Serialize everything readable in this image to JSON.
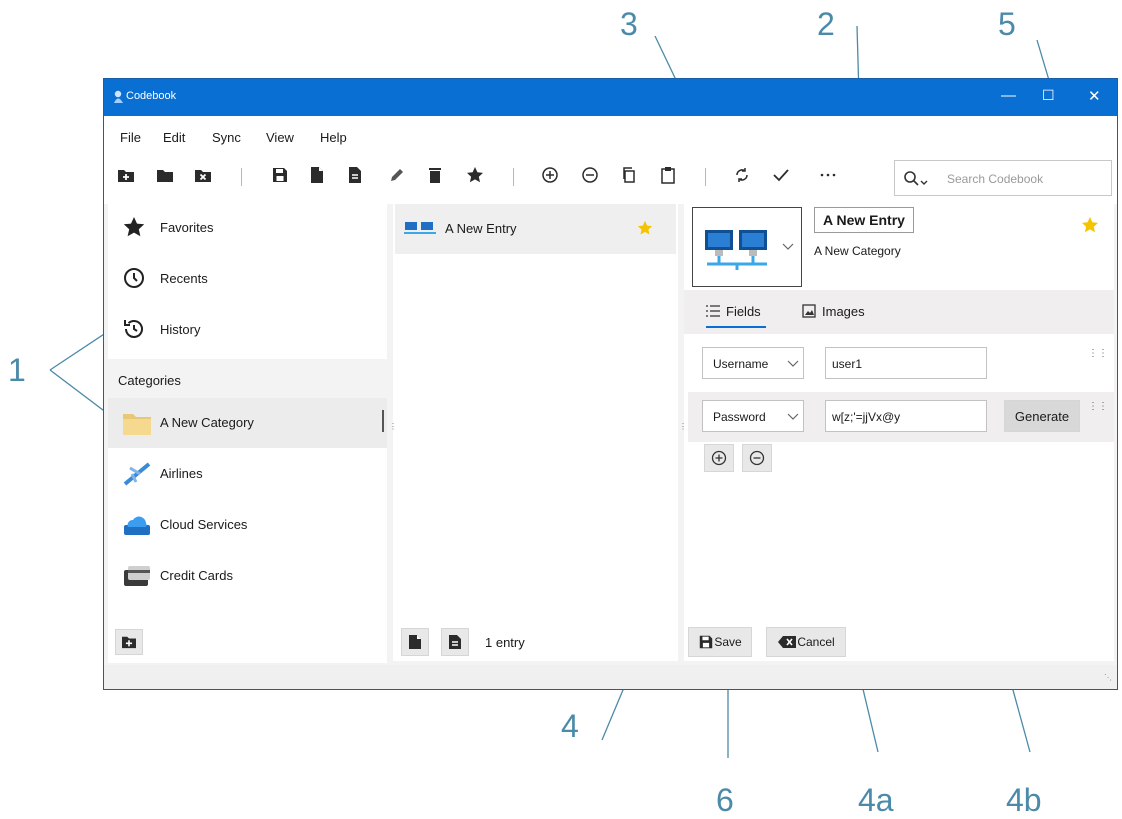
{
  "window": {
    "title": "Codebook"
  },
  "menu": [
    "File",
    "Edit",
    "Sync",
    "View",
    "Help"
  ],
  "toolbar": {
    "icons": [
      "add-folder-icon",
      "folder-icon",
      "delete-folder-icon",
      "save-icon",
      "new-entry-icon",
      "new-document-icon",
      "edit-icon",
      "delete-icon",
      "favorite-star-icon",
      "add-circle-icon",
      "remove-circle-icon",
      "copy-icon",
      "paste-icon",
      "sync-icon",
      "check-icon",
      "more-icon"
    ],
    "search_placeholder": "Search Codebook"
  },
  "nav": {
    "items": [
      {
        "label": "Favorites",
        "icon": "star-icon"
      },
      {
        "label": "Recents",
        "icon": "clock-icon"
      },
      {
        "label": "History",
        "icon": "history-icon"
      }
    ],
    "categories_header": "Categories",
    "categories": [
      {
        "label": "A New Category",
        "icon": "folder-icon"
      },
      {
        "label": "Airlines",
        "icon": "airplane-icon"
      },
      {
        "label": "Cloud Services",
        "icon": "cloud-icon"
      },
      {
        "label": "Credit Cards",
        "icon": "credit-card-icon"
      }
    ]
  },
  "entries": {
    "items": [
      {
        "label": "A New Entry",
        "favorite": true
      }
    ],
    "count": "1 entry"
  },
  "detail": {
    "entry_name": "A New Entry",
    "category": "A New Category",
    "tabs": [
      "Fields",
      "Images"
    ],
    "fields": [
      {
        "type": "Username",
        "value": "user1"
      },
      {
        "type": "Password",
        "value": "w[z;'=jjVx@y",
        "action": "Generate"
      }
    ],
    "save_label": "Save",
    "cancel_label": "Cancel"
  },
  "callouts": [
    "1",
    "2",
    "3",
    "4",
    "4a",
    "4b",
    "5",
    "6"
  ],
  "colors": {
    "titlebar": "#0a6fd2",
    "callout": "#4b8aa8",
    "star": "#f5c400"
  }
}
